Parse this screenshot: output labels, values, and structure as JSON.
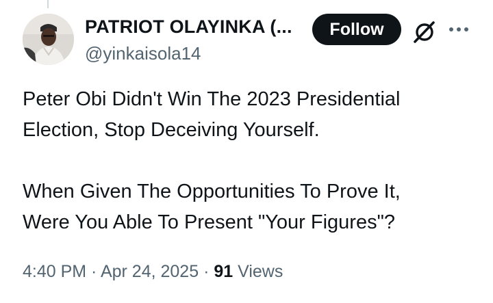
{
  "author": {
    "display_name": "PATRIOT OLAYINKA (...",
    "handle": "@yinkaisola14",
    "avatar_icon": "profile-photo"
  },
  "actions": {
    "follow_label": "Follow",
    "grok_icon": "grok-icon",
    "more_icon": "more-options-icon"
  },
  "tweet": {
    "lines_paragraph_1": [
      "Peter Obi Didn't Win The 2023 Presidential",
      "Election, Stop Deceiving Yourself."
    ],
    "lines_paragraph_2": [
      "When Given The Opportunities To Prove It,",
      "Were You Able To Present \"Your Figures\"?"
    ]
  },
  "meta": {
    "time": "4:40 PM",
    "separator_1": " · ",
    "date": "Apr 24, 2025",
    "separator_2": " · ",
    "views_count": "91",
    "views_label": " Views"
  },
  "colors": {
    "text_primary": "#0f1419",
    "text_secondary": "#536471",
    "button_bg": "#0f1419",
    "button_text": "#ffffff"
  }
}
